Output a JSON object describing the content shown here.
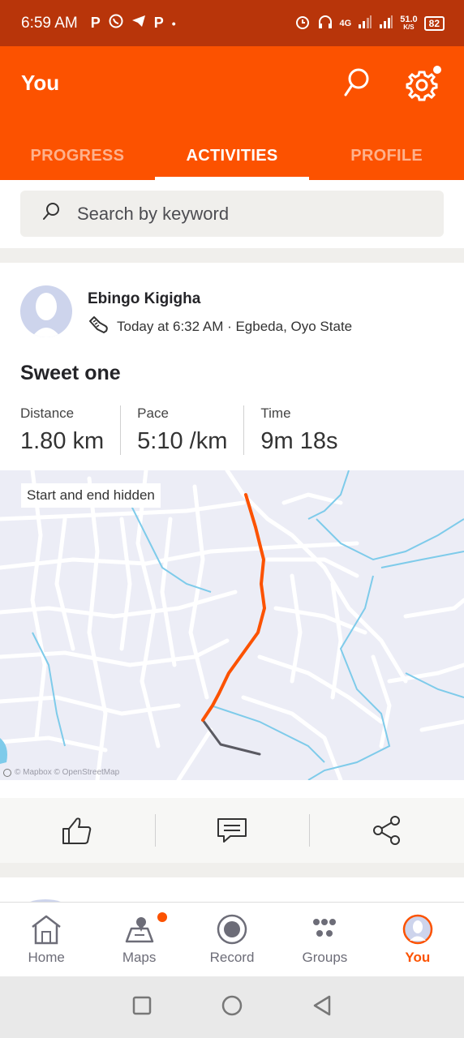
{
  "status_bar": {
    "time": "6:59 AM",
    "network": "4G",
    "speed": "51.0",
    "speed_unit": "K/S",
    "battery": "82"
  },
  "header": {
    "title": "You"
  },
  "tabs": [
    {
      "label": "PROGRESS",
      "active": false
    },
    {
      "label": "ACTIVITIES",
      "active": true
    },
    {
      "label": "PROFILE",
      "active": false
    }
  ],
  "search": {
    "placeholder": "Search by keyword"
  },
  "activity": {
    "athlete": "Ebingo Kigigha",
    "meta": "Today at 6:32 AM · Egbeda, Oyo State",
    "name": "Sweet one",
    "stats": [
      {
        "label": "Distance",
        "value": "1.80 km"
      },
      {
        "label": "Pace",
        "value": "5:10 /km"
      },
      {
        "label": "Time",
        "value": "9m 18s"
      }
    ],
    "map_badge": "Start and end hidden",
    "map_attribution": "© Mapbox © OpenStreetMap"
  },
  "bottom_nav": [
    {
      "label": "Home",
      "icon": "home-icon"
    },
    {
      "label": "Maps",
      "icon": "maps-icon"
    },
    {
      "label": "Record",
      "icon": "record-icon"
    },
    {
      "label": "Groups",
      "icon": "groups-icon"
    },
    {
      "label": "You",
      "icon": "avatar-icon"
    }
  ],
  "colors": {
    "brand": "#fc5200",
    "status_bar": "#b8350a"
  }
}
